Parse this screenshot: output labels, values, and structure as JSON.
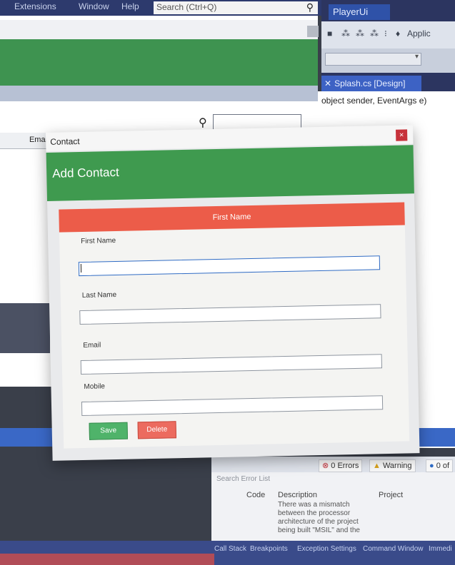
{
  "vs": {
    "menu": [
      "Extensions",
      "Window",
      "Help"
    ],
    "search_placeholder": "Search (Ctrl+Q)",
    "solution_name": "PlayerUi",
    "toolbar_app": "Applic",
    "tab_splash": "Splash.cs [Design]",
    "code_line": "object sender, EventArgs e)",
    "left_column_header": "Emai",
    "error_list": {
      "search": "Search Error List",
      "errors_label": "0 Errors",
      "warning_label": "Warning",
      "messages_label": "0 of",
      "col_code": "Code",
      "col_description": "Description",
      "col_project": "Project",
      "row_description": "There was a mismatch between the processor architecture of the project being built \"MSIL\" and the"
    },
    "status_tabs": [
      "Call Stack",
      "Breakpoints",
      "Exception Settings",
      "Command Window",
      "Immedi"
    ]
  },
  "dialog": {
    "window_title": "Contact",
    "close_glyph": "×",
    "heading": "Add Contact",
    "banner": "First Name",
    "fields": {
      "first_name_label": "First Name",
      "last_name_label": "Last Name",
      "email_label": "Email",
      "mobile_label": "Mobile",
      "first_name_value": "",
      "last_name_value": "",
      "email_value": "",
      "mobile_value": ""
    },
    "buttons": {
      "save": "Save",
      "delete": "Delete"
    }
  },
  "colors": {
    "green_header": "#3f9a4f",
    "banner_red": "#ec5c49",
    "save_green": "#4fb36a",
    "delete_red": "#ec6b5f",
    "vs_blue": "#3a68c6"
  }
}
